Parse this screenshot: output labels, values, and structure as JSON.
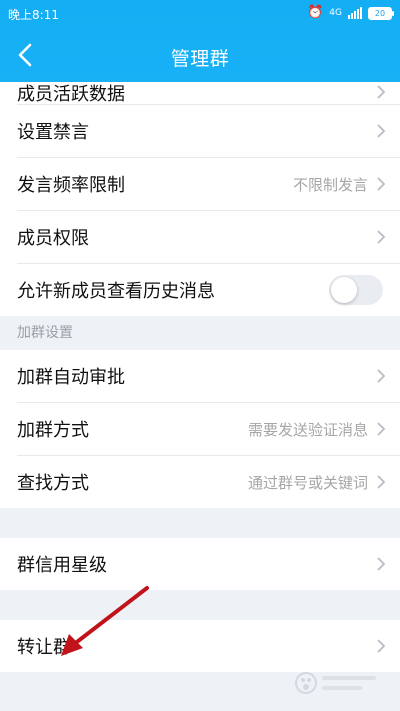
{
  "status_bar": {
    "time": "晚上8:11",
    "network": "4G",
    "battery": "20"
  },
  "header": {
    "title": "管理群"
  },
  "group1": {
    "items": [
      {
        "label": "成员活跃数据"
      },
      {
        "label": "设置禁言"
      },
      {
        "label": "发言频率限制",
        "value": "不限制发言"
      },
      {
        "label": "成员权限"
      },
      {
        "label": "允许新成员查看历史消息",
        "toggle_on": false
      }
    ]
  },
  "group2": {
    "section_title": "加群设置",
    "items": [
      {
        "label": "加群自动审批"
      },
      {
        "label": "加群方式",
        "value": "需要发送验证消息"
      },
      {
        "label": "查找方式",
        "value": "通过群号或关键词"
      }
    ]
  },
  "group3": {
    "items": [
      {
        "label": "群信用星级"
      }
    ]
  },
  "group4": {
    "items": [
      {
        "label": "转让群"
      }
    ]
  },
  "annotation": {
    "arrow_color": "#c0141a"
  },
  "theme": {
    "header_blue": "#16b0f5",
    "divider": "#e6e9ee"
  }
}
